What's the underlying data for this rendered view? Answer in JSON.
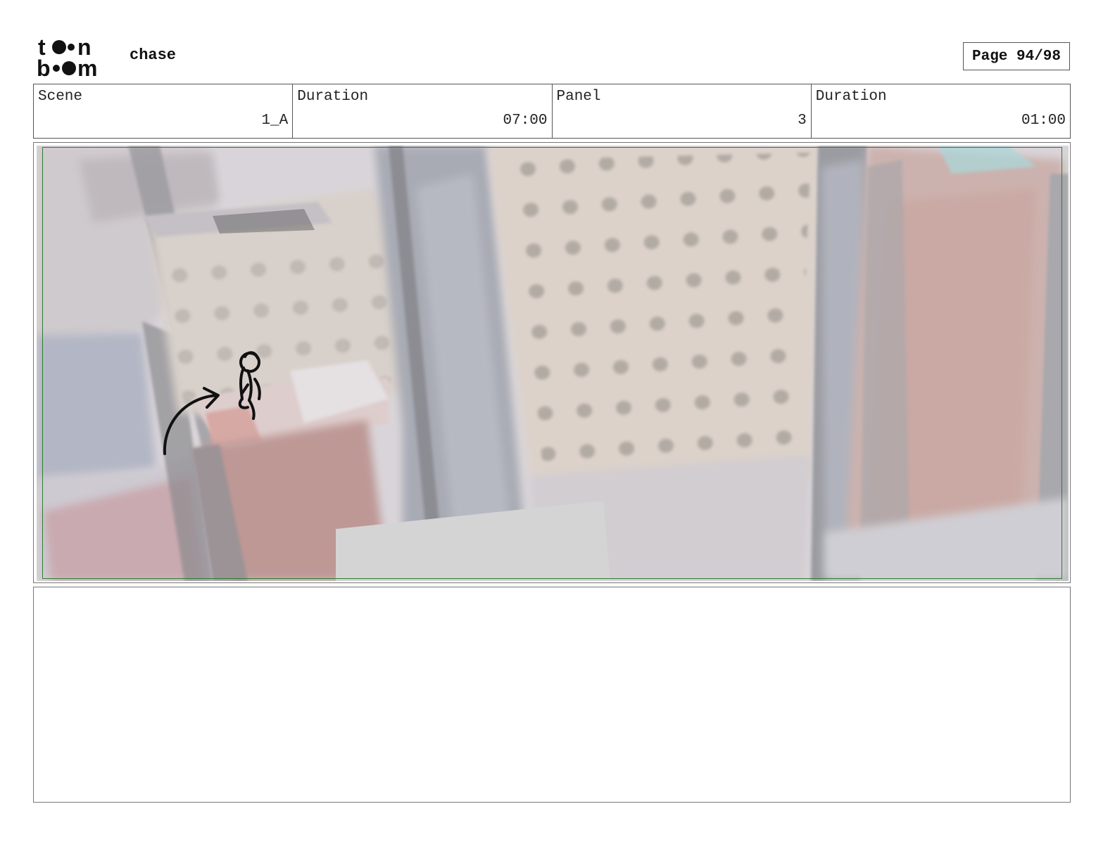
{
  "header": {
    "logo_text": "toon boom",
    "project_title": "chase",
    "page_label": "Page 94/98"
  },
  "info": [
    {
      "label": "Scene",
      "value": "1_A"
    },
    {
      "label": "Duration",
      "value": "07:00"
    },
    {
      "label": "Panel",
      "value": "3"
    },
    {
      "label": "Duration",
      "value": "01:00"
    }
  ],
  "panel": {
    "image_name": "storyboard-panel-art",
    "safe_area_color": "#2e7d32"
  },
  "notes": {
    "text": ""
  },
  "colors": {
    "border": "#555555",
    "text": "#111111"
  }
}
